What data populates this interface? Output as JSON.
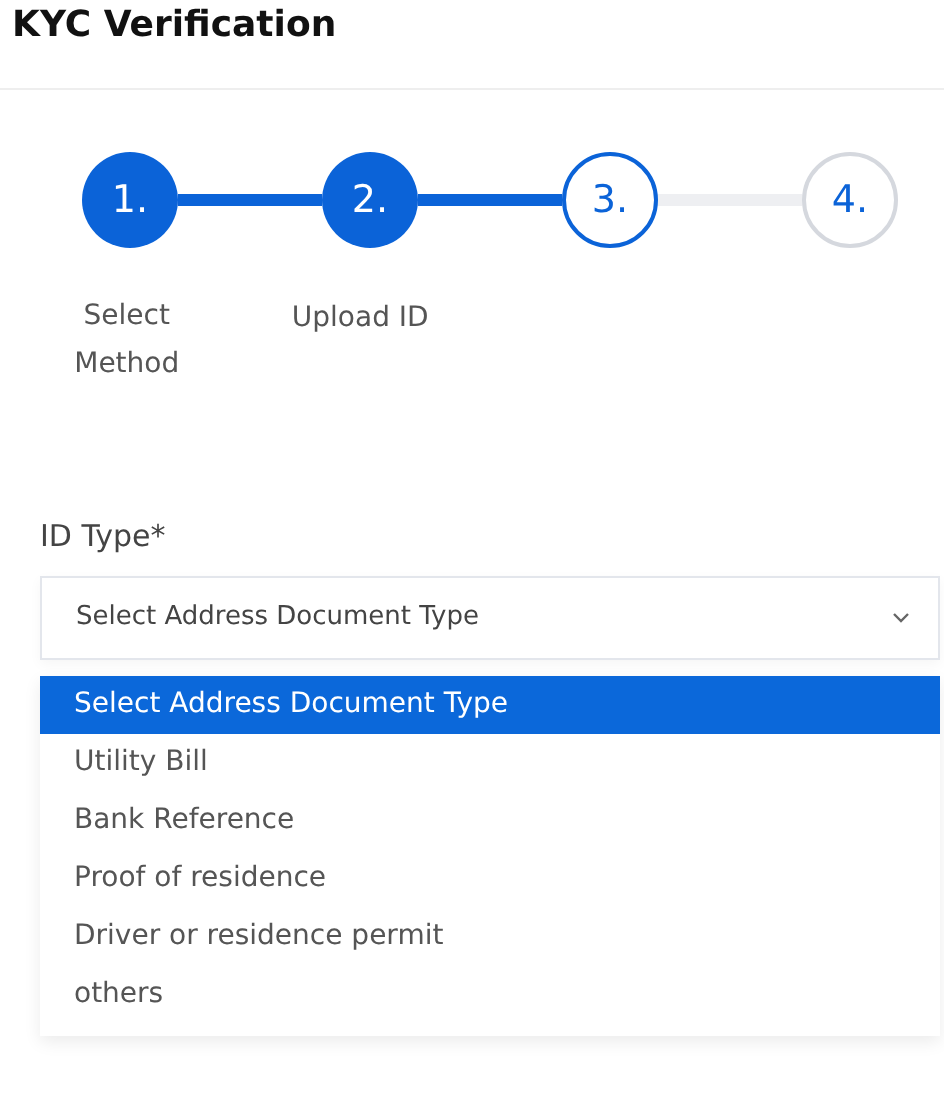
{
  "title": "KYC Verification",
  "steps": [
    {
      "number": "1.",
      "label": "Select Method",
      "completed": true,
      "current": false
    },
    {
      "number": "2.",
      "label": "Upload ID",
      "completed": true,
      "current": false
    },
    {
      "number": "3.",
      "completed": false,
      "current": true
    },
    {
      "number": "4.",
      "completed": false,
      "current": false
    }
  ],
  "field": {
    "label": "ID Type*",
    "value": "Select Address Document Type",
    "expanded": true
  },
  "options": [
    {
      "label": "Select Address Document Type",
      "selected": true
    },
    {
      "label": "Utility Bill",
      "selected": false
    },
    {
      "label": "Bank Reference",
      "selected": false
    },
    {
      "label": "Proof of residence",
      "selected": false
    },
    {
      "label": "Driver or residence permit",
      "selected": false
    },
    {
      "label": "others",
      "selected": false
    }
  ]
}
